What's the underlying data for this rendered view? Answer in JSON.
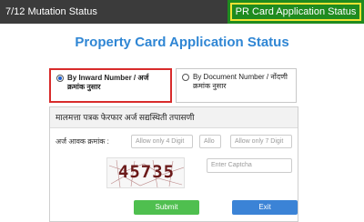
{
  "topbar": {
    "left_tab": "7/12 Mutation Status",
    "right_tab": "PR Card Application Status",
    "colors": {
      "bar": "#3b3b3b",
      "active_tab": "#1f8b1f",
      "active_tab_border": "#f2e233"
    }
  },
  "page": {
    "title": "Property Card Application Status",
    "title_color": "#2f86d4"
  },
  "search_options": [
    {
      "label": "By Inward Number / अर्ज क्रमांक नुसार",
      "selected": true
    },
    {
      "label": "By Document Number / नोंदणी क्रमांक नुसार",
      "selected": false
    }
  ],
  "panel": {
    "heading": "मालमत्ता पत्रक फेरफार अर्ज सद्यस्थिती तपासणी",
    "field_label": "अर्ज आवक क्रमांक :",
    "input1_placeholder": "Allow only 4 Digit",
    "input2_placeholder": "Allo",
    "input3_placeholder": "Allow only 7 Digit",
    "captcha_value": "45735",
    "captcha_placeholder": "Enter Captcha",
    "submit_label": "Submit",
    "exit_label": "Exit",
    "colors": {
      "submit": "#4fbf4f",
      "exit": "#3b83d6"
    }
  }
}
